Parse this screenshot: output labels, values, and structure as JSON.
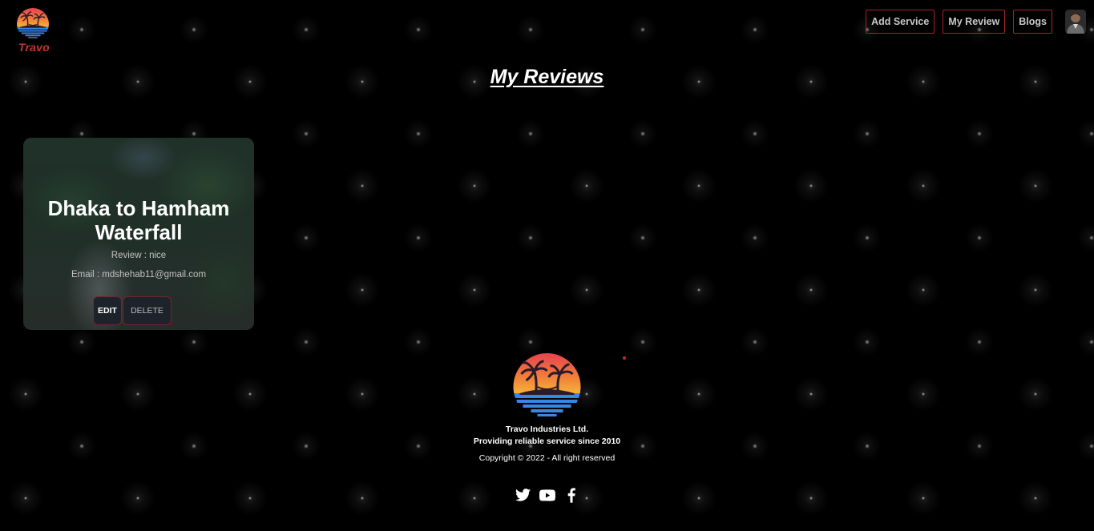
{
  "brand": {
    "name": "Travo",
    "logo_icon": "sunset-palm-logo",
    "accent_color": "#c4372f"
  },
  "nav": {
    "items": [
      {
        "label": "Add Service"
      },
      {
        "label": "My Review"
      },
      {
        "label": "Blogs"
      }
    ],
    "avatar_icon": "user-avatar"
  },
  "page": {
    "title": "My Reviews"
  },
  "reviews": [
    {
      "service_name": "Dhaka to Hamham Waterfall",
      "review_text": "Review : nice",
      "email_text": "Email : mdshehab11@gmail.com",
      "edit_label": "EDIT",
      "delete_label": "DELETE"
    }
  ],
  "footer": {
    "company": "Travo Industries Ltd.",
    "tagline": "Providing reliable service since 2010",
    "copyright": "Copyright © 2022 - All right reserved",
    "social_icons": [
      "twitter-icon",
      "youtube-icon",
      "facebook-icon"
    ]
  }
}
